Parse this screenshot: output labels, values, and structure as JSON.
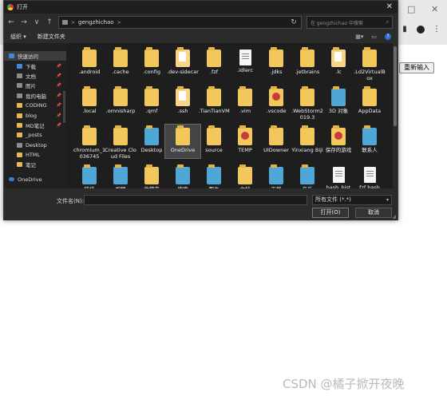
{
  "background": {
    "button_label": "重新输入",
    "watermark": "CSDN @橘子掀开夜晚"
  },
  "dialog": {
    "title": "打开",
    "close_symbol": "✕",
    "nav": {
      "back": "←",
      "forward": "→",
      "up_menu": "∨",
      "up": "↑"
    },
    "address": {
      "user_segment": "gengzhichao",
      "chevron": ">",
      "refresh": "↻"
    },
    "search_placeholder": "在 gengzhichao 中搜索",
    "toolbar": {
      "organize": "组织 ▾",
      "new_folder": "新建文件夹"
    },
    "sidebar": [
      {
        "label": "快速访问",
        "icon": "star-icon",
        "indent": false,
        "pinned": false,
        "selected": true
      },
      {
        "label": "下载",
        "icon": "download-icon",
        "indent": true,
        "pinned": true
      },
      {
        "label": "文档",
        "icon": "document-icon",
        "indent": true,
        "pinned": true
      },
      {
        "label": "图片",
        "icon": "picture-icon",
        "indent": true,
        "pinned": true
      },
      {
        "label": "我的电脑",
        "icon": "computer-icon",
        "indent": true,
        "pinned": true
      },
      {
        "label": "CODING",
        "icon": "folder-icon",
        "indent": true,
        "pinned": true
      },
      {
        "label": "blog",
        "icon": "folder-icon",
        "indent": true,
        "pinned": true
      },
      {
        "label": "MD笔记",
        "icon": "folder-icon",
        "indent": true,
        "pinned": true
      },
      {
        "label": "_posts",
        "icon": "folder-icon",
        "indent": true,
        "pinned": false
      },
      {
        "label": "Desktop",
        "icon": "desktop-icon",
        "indent": true,
        "pinned": false
      },
      {
        "label": "HTML",
        "icon": "folder-icon",
        "indent": true,
        "pinned": false
      },
      {
        "label": "笔记",
        "icon": "folder-icon",
        "indent": true,
        "pinned": false
      },
      {
        "label": "OneDrive",
        "icon": "cloud-icon",
        "indent": false,
        "pinned": false
      }
    ],
    "files": [
      {
        "label": ".android",
        "icon": "folder"
      },
      {
        "label": ".cache",
        "icon": "folder"
      },
      {
        "label": ".config",
        "icon": "folder"
      },
      {
        "label": ".dev-sidecar",
        "icon": "folder-paper"
      },
      {
        "label": ".fzf",
        "icon": "folder"
      },
      {
        "label": ".idlerc",
        "icon": "document"
      },
      {
        "label": ".jdks",
        "icon": "folder"
      },
      {
        "label": ".jetbrains",
        "icon": "folder"
      },
      {
        "label": ".lc",
        "icon": "folder-paper"
      },
      {
        "label": ".Ld2VirtualBox",
        "icon": "folder"
      },
      {
        "label": ".local",
        "icon": "folder"
      },
      {
        "label": ".omnisharp",
        "icon": "folder"
      },
      {
        "label": ".qmf",
        "icon": "folder"
      },
      {
        "label": ".ssh",
        "icon": "folder-paper"
      },
      {
        "label": ".TianTianVM",
        "icon": "folder"
      },
      {
        "label": ".vim",
        "icon": "folder"
      },
      {
        "label": ".vscode",
        "icon": "folder-special"
      },
      {
        "label": ".WebStorm2019.3",
        "icon": "folder"
      },
      {
        "label": "3D 对象",
        "icon": "folder-thumb"
      },
      {
        "label": "AppData",
        "icon": "folder"
      },
      {
        "label": "chromium_1036745",
        "icon": "folder"
      },
      {
        "label": "Creative Cloud Files",
        "icon": "folder"
      },
      {
        "label": "Desktop",
        "icon": "folder-thumb"
      },
      {
        "label": "OneDrive",
        "icon": "folder"
      },
      {
        "label": "source",
        "icon": "folder"
      },
      {
        "label": "TEMP",
        "icon": "folder-special"
      },
      {
        "label": "UIDowner",
        "icon": "folder"
      },
      {
        "label": "Yinxiang Biji",
        "icon": "folder"
      },
      {
        "label": "保存的游戏",
        "icon": "folder-special"
      },
      {
        "label": "联系人",
        "icon": "folder-thumb"
      },
      {
        "label": "链接",
        "icon": "folder-thumb"
      },
      {
        "label": "视频",
        "icon": "folder-thumb"
      },
      {
        "label": "收藏夹",
        "icon": "folder"
      },
      {
        "label": "搜索",
        "icon": "folder-thumb"
      },
      {
        "label": "图片",
        "icon": "folder-thumb"
      },
      {
        "label": "文档",
        "icon": "folder"
      },
      {
        "label": "下载",
        "icon": "folder-thumb"
      },
      {
        "label": "音乐",
        "icon": "folder-thumb"
      },
      {
        "label": "bash_hist",
        "icon": "document"
      },
      {
        "label": "fzf bash",
        "icon": "document"
      }
    ],
    "selected_file": "OneDrive",
    "bottom": {
      "filename_label": "文件名(N):",
      "filename_value": "",
      "filetype": "所有文件 (*.*)",
      "open_button": "打开(O)",
      "cancel_button": "取消"
    },
    "colors": {
      "background": "#2b2b2b",
      "folder": "#f2c75c",
      "accent": "#2a6fd1"
    }
  }
}
